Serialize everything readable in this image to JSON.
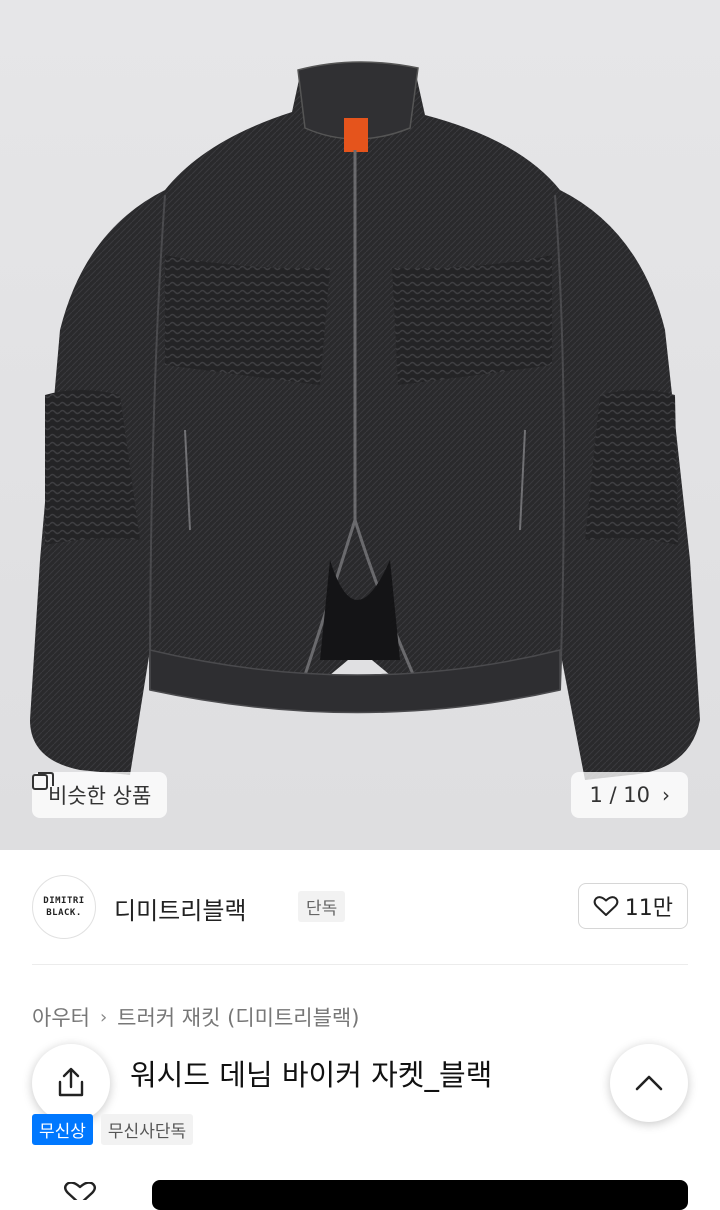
{
  "gallery": {
    "similar_label": "비슷한 상품",
    "similar_icon": "similar-items-icon",
    "counter": "1 / 10",
    "next_icon": "chevron-right-icon"
  },
  "brand": {
    "logo_line1": "DIMITRI",
    "logo_line2": "BLACK.",
    "name": "디미트리블랙",
    "badge": "단독"
  },
  "likes": {
    "count": "11만",
    "icon": "heart-outline-icon"
  },
  "breadcrumb": {
    "category": "아우터",
    "subcategory": "트러커 재킷 (디미트리블랙)"
  },
  "product": {
    "title": "워시드 데님 바이커 자켓_블랙",
    "tags": [
      "무신상",
      "무신사단독"
    ]
  },
  "actions": {
    "share_icon": "share-icon",
    "scroll_top_icon": "chevron-up-icon"
  },
  "colors": {
    "accent_blue": "#0078ff",
    "buy_bar": "#000000"
  }
}
